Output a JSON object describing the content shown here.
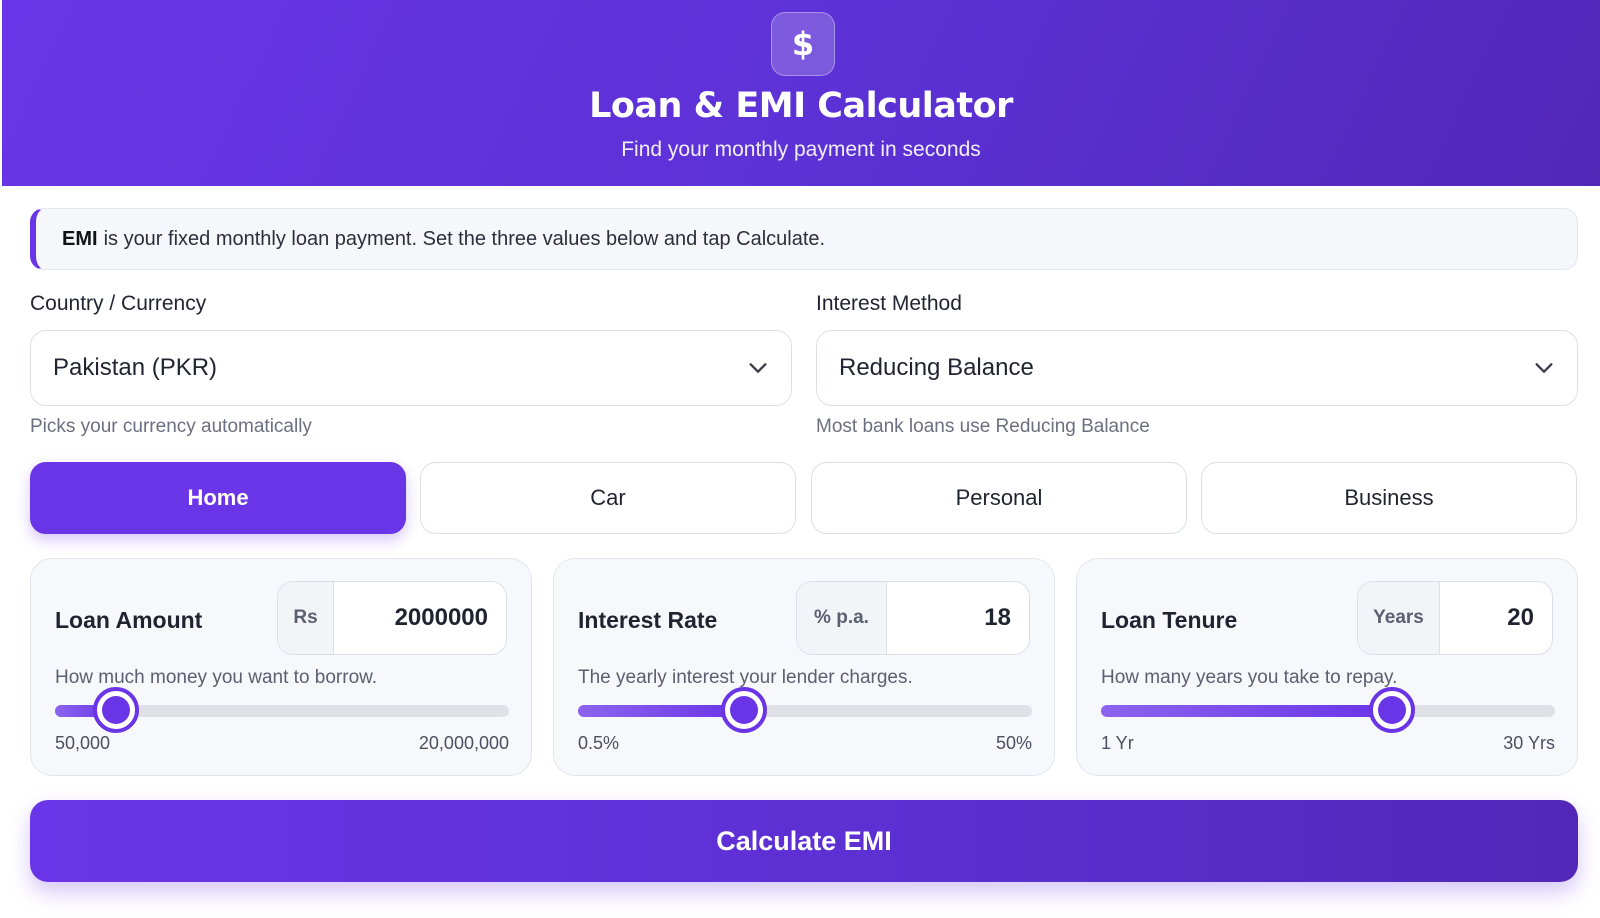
{
  "header": {
    "icon": "dollar-icon",
    "icon_glyph": "$",
    "title": "Loan & EMI Calculator",
    "subtitle": "Find your monthly payment in seconds"
  },
  "info": {
    "bold": "EMI",
    "text": "is your fixed monthly loan payment. Set the three values below and tap Calculate."
  },
  "country": {
    "label": "Country / Currency",
    "selected": "Pakistan (PKR)",
    "helper": "Picks your currency automatically"
  },
  "method": {
    "label": "Interest Method",
    "selected": "Reducing Balance",
    "helper": "Most bank loans use Reducing Balance"
  },
  "loan_types": [
    {
      "label": "Home",
      "active": true
    },
    {
      "label": "Car",
      "active": false
    },
    {
      "label": "Personal",
      "active": false
    },
    {
      "label": "Business",
      "active": false
    }
  ],
  "inputs": {
    "amount": {
      "title": "Loan Amount",
      "unit": "Rs",
      "value": "2000000",
      "helper": "How much money you want to borrow.",
      "min_label": "50,000",
      "max_label": "20,000,000",
      "slider_fraction": 0.135
    },
    "rate": {
      "title": "Interest Rate",
      "unit": "% p.a.",
      "value": "18",
      "helper": "The yearly interest your lender charges.",
      "min_label": "0.5%",
      "max_label": "50%",
      "slider_fraction": 0.365
    },
    "tenure": {
      "title": "Loan Tenure",
      "unit": "Years",
      "value": "20",
      "helper": "How many years you take to repay.",
      "min_label": "1 Yr",
      "max_label": "30 Yrs",
      "slider_fraction": 0.64
    }
  },
  "calculate_label": "Calculate EMI",
  "colors": {
    "accent": "#6a35e6",
    "accent_dark": "#5227b8"
  }
}
